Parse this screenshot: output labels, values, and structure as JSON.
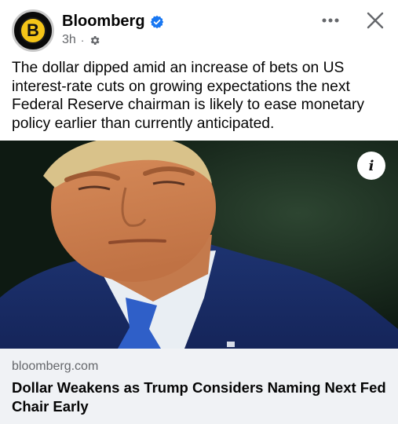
{
  "post": {
    "page_name": "Bloomberg",
    "avatar_letter": "B",
    "timestamp": "3h",
    "meta_separator": "·",
    "verified_icon": "verified-badge-icon",
    "privacy_icon": "gear-icon",
    "more_icon": "more-horizontal-icon",
    "close_icon": "close-icon",
    "text": "The dollar dipped amid an increase of bets on US interest-rate cuts on growing expectations the next Federal Reserve chairman is likely to ease monetary policy earlier than currently anticipated."
  },
  "image": {
    "info_label": "i"
  },
  "link_preview": {
    "domain": "bloomberg.com",
    "title": "Dollar Weakens as Trump Considers Naming Next Fed Chair Early"
  },
  "colors": {
    "verified_blue": "#1877f2",
    "secondary_text": "#65676b",
    "card_background": "#f0f2f5",
    "avatar_yellow": "#f5c518"
  }
}
